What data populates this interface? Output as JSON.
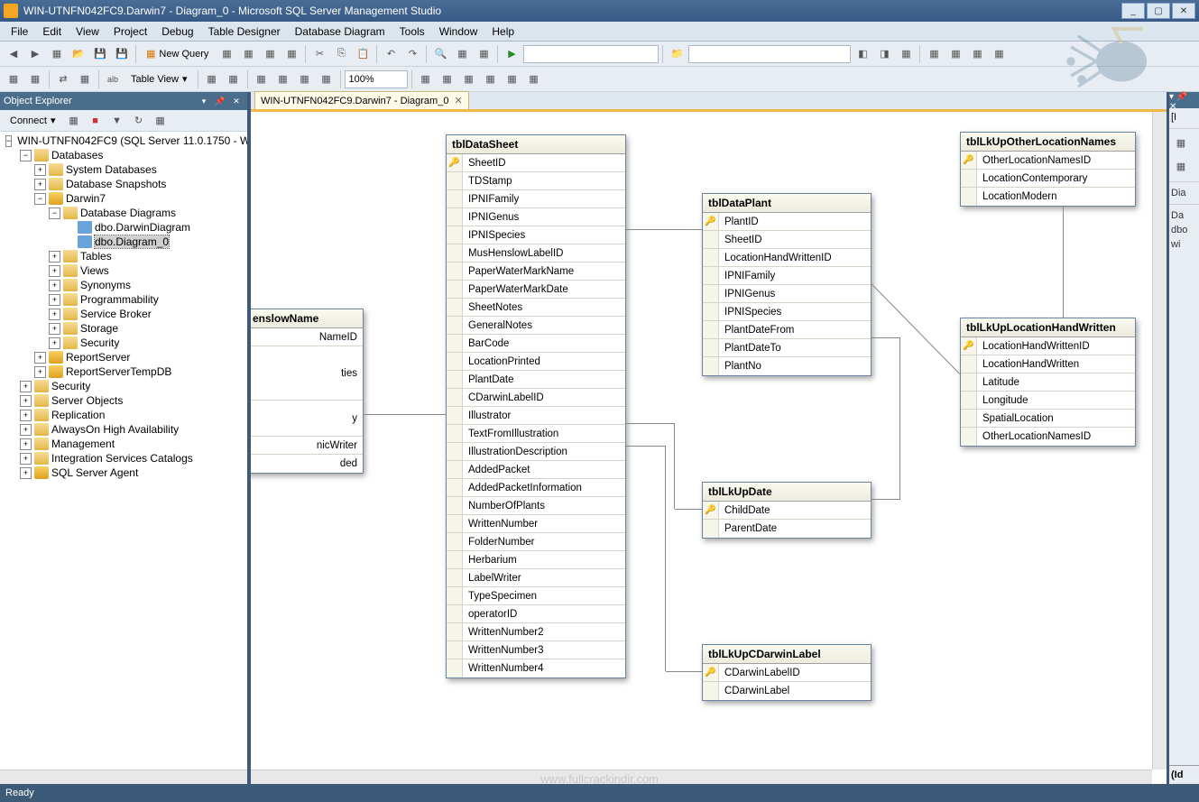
{
  "window": {
    "title": "WIN-UTNFN042FC9.Darwin7 - Diagram_0 - Microsoft SQL Server Management Studio"
  },
  "menubar": [
    "File",
    "Edit",
    "View",
    "Project",
    "Debug",
    "Table Designer",
    "Database Diagram",
    "Tools",
    "Window",
    "Help"
  ],
  "toolbar1": {
    "new_query": "New Query",
    "zoom_value": "100%",
    "table_view": "Table View"
  },
  "panel": {
    "object_explorer": "Object Explorer",
    "connect": "Connect"
  },
  "tree": {
    "server": "WIN-UTNFN042FC9 (SQL Server 11.0.1750 - W",
    "nodes": {
      "databases": "Databases",
      "sysdb": "System Databases",
      "snapshots": "Database Snapshots",
      "darwin7": "Darwin7",
      "dbdiag": "Database Diagrams",
      "diag1": "dbo.DarwinDiagram",
      "diag2": "dbo.Diagram_0",
      "tables": "Tables",
      "views": "Views",
      "syn": "Synonyms",
      "prog": "Programmability",
      "sb": "Service Broker",
      "storage": "Storage",
      "dbsec": "Security",
      "rs": "ReportServer",
      "rstmp": "ReportServerTempDB",
      "sec": "Security",
      "sobj": "Server Objects",
      "repl": "Replication",
      "aoha": "AlwaysOn High Availability",
      "mgmt": "Management",
      "isc": "Integration Services Catalogs",
      "agent": "SQL Server Agent"
    }
  },
  "tab": {
    "label": "WIN-UTNFN042FC9.Darwin7 - Diagram_0"
  },
  "tables": {
    "tblDataSheet": {
      "title": "tblDataSheet",
      "pk": "SheetID",
      "cols": [
        "TDStamp",
        "IPNIFamily",
        "IPNIGenus",
        "IPNISpecies",
        "MusHenslowLabelID",
        "PaperWaterMarkName",
        "PaperWaterMarkDate",
        "SheetNotes",
        "GeneralNotes",
        "BarCode",
        "LocationPrinted",
        "PlantDate",
        "CDarwinLabelID",
        "Illustrator",
        "TextFromIllustration",
        "IllustrationDescription",
        "AddedPacket",
        "AddedPacketInformation",
        "NumberOfPlants",
        "WrittenNumber",
        "FolderNumber",
        "Herbarium",
        "LabelWriter",
        "TypeSpecimen",
        "operatorID",
        "WrittenNumber2",
        "WrittenNumber3",
        "WrittenNumber4"
      ]
    },
    "tblDataPlant": {
      "title": "tblDataPlant",
      "pk": "PlantID",
      "cols": [
        "SheetID",
        "LocationHandWrittenID",
        "IPNIFamily",
        "IPNIGenus",
        "IPNISpecies",
        "PlantDateFrom",
        "PlantDateTo",
        "PlantNo"
      ]
    },
    "tblLkUpDate": {
      "title": "tblLkUpDate",
      "pk": "ChildDate",
      "cols": [
        "ParentDate"
      ]
    },
    "tblLkUpCDarwinLabel": {
      "title": "tblLkUpCDarwinLabel",
      "pk": "CDarwinLabelID",
      "cols": [
        "CDarwinLabel"
      ]
    },
    "tblLkUpOtherLocationNames": {
      "title": "tblLkUpOtherLocationNames",
      "pk": "OtherLocationNamesID",
      "cols": [
        "LocationContemporary",
        "LocationModern"
      ]
    },
    "tblLkUpLocationHandWritten": {
      "title": "tblLkUpLocationHandWritten",
      "pk": "LocationHandWrittenID",
      "cols": [
        "LocationHandWritten",
        "Latitude",
        "Longitude",
        "SpatialLocation",
        "OtherLocationNamesID"
      ]
    },
    "henslowName": {
      "title": "enslowName",
      "headerRaw": "enslowName",
      "cols_partial": [
        "NameID",
        "ties",
        "y",
        "nicWriter",
        "ded"
      ]
    }
  },
  "right_panel": {
    "header_frag": "[I",
    "line1": "Dia",
    "line2": "Da",
    "line3": "dbo",
    "line4": "wi",
    "footer": "(Id"
  },
  "statusbar": {
    "ready": "Ready"
  },
  "watermark": "www.fullcrackindir.com"
}
